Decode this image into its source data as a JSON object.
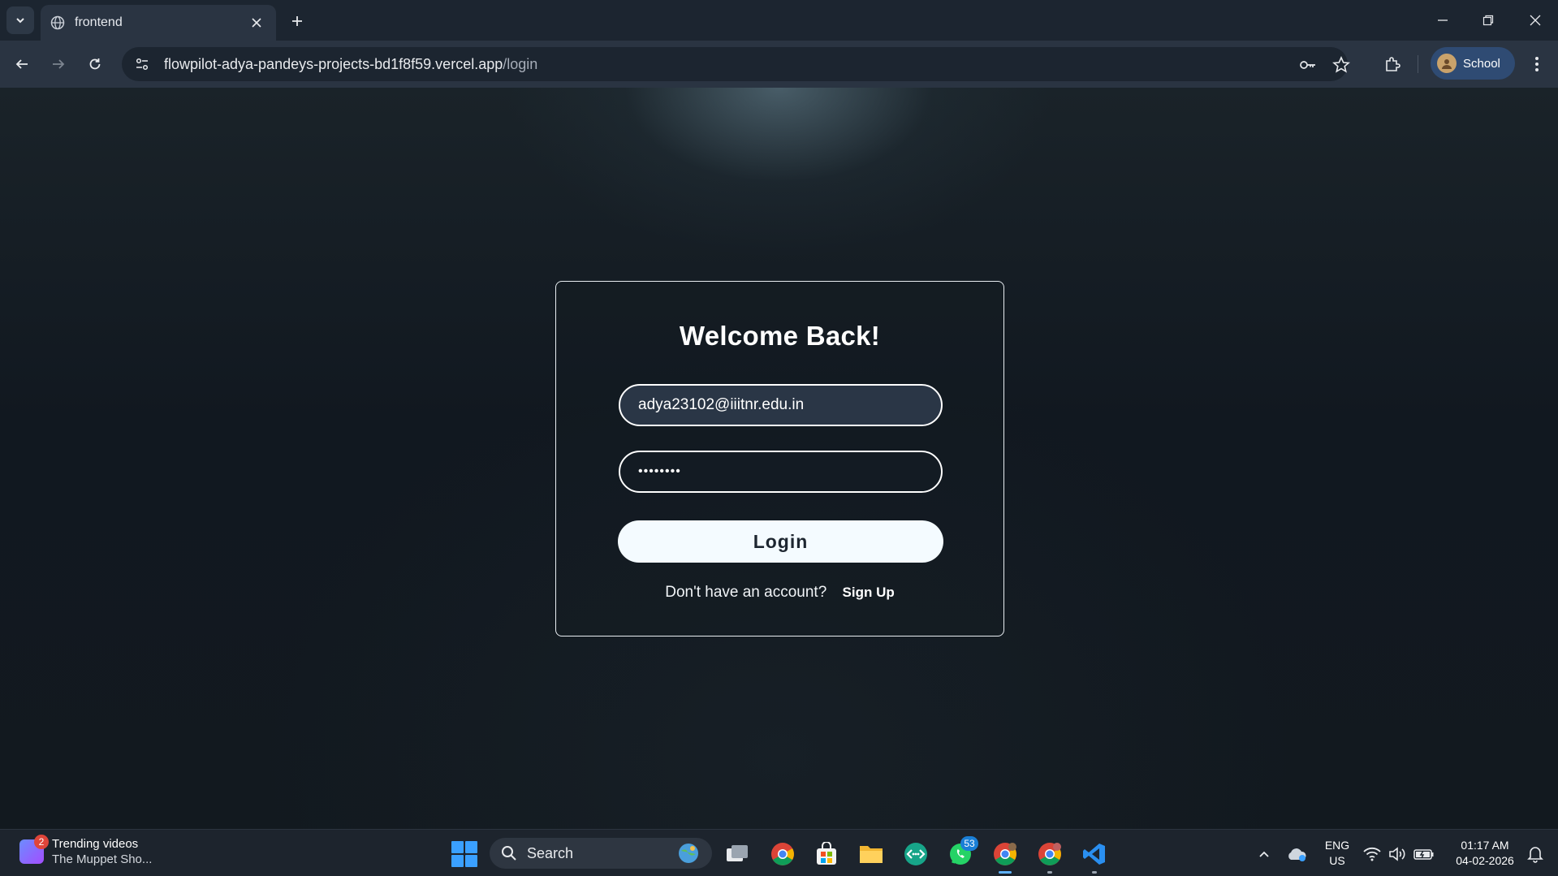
{
  "browser": {
    "tab_title": "frontend",
    "url_host": "flowpilot-adya-pandeys-projects-bd1f8f59.vercel.app",
    "url_path": "/login",
    "profile_label": "School"
  },
  "login": {
    "title": "Welcome Back!",
    "email_value": "adya23102@iiitnr.edu.in",
    "password_value": "********",
    "login_label": "Login",
    "signup_prompt": "Don't have an account?",
    "signup_link": "Sign Up"
  },
  "taskbar": {
    "widget_badge": "2",
    "widget_title": "Trending videos",
    "widget_subtitle": "The Muppet Sho...",
    "search_label": "Search",
    "whatsapp_badge": "53",
    "language": "ENG",
    "region": "US",
    "time": "01:17 AM",
    "date": "04-02-2026"
  },
  "colors": {
    "accent": "#3aa0ff",
    "profile_chip": "#2f4b73",
    "button_bg": "#f4fbff"
  }
}
